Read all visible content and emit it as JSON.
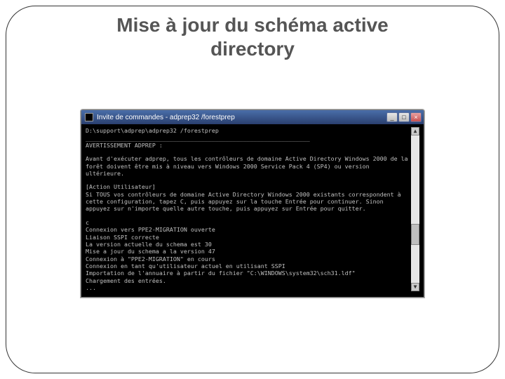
{
  "slide": {
    "title": "Mise à jour du schéma active directory"
  },
  "window": {
    "title": "Invite de commandes - adprep32 /forestprep",
    "buttons": {
      "min": "_",
      "max": "□",
      "close": "×"
    }
  },
  "console": {
    "line_prompt": "D:\\support\\adprep\\adprep32 /forestprep",
    "line_hr": "________________________________________________________________",
    "line_warn": "AVERTISSEMENT ADPREP :",
    "line_p1": "Avant d'exécuter adprep, tous les contrôleurs de domaine Active Directory Windows 2000 de la forêt doivent être mis à niveau vers Windows 2000 Service Pack 4 (SP4) ou version ultérieure.",
    "line_action": "[Action Utilisateur]",
    "line_p2": "Si TOUS vos contrôleurs de domaine Active Directory Windows 2000 existants correspondent à cette configuration, tapez C, puis appuyez sur la touche Entrée pour continuer. Sinon appuyez sur n'importe quelle autre touche, puis appuyez sur Entrée pour quitter.",
    "line_c": "c",
    "line_conn": "Connexion vers PPE2-MIGRATION ouverte",
    "line_liaison": "Liaison SSPI correcte",
    "line_ver": "La version actuelle du schema est 30",
    "line_maj": "Mise a jour du schema a la version 47",
    "line_conn2": "Connexion à \"PPE2-MIGRATION\" en cours",
    "line_sspi": "Connexion en tant qu'utilisateur actuel en utilisant SSPI",
    "line_import": "Importation de l'annuaire à partir du fichier \"C:\\WINDOWS\\system32\\sch31.ldf\"",
    "line_load": "Chargement des entrées.",
    "line_dots": "..."
  },
  "scrollbar": {
    "up": "▲",
    "down": "▼"
  }
}
